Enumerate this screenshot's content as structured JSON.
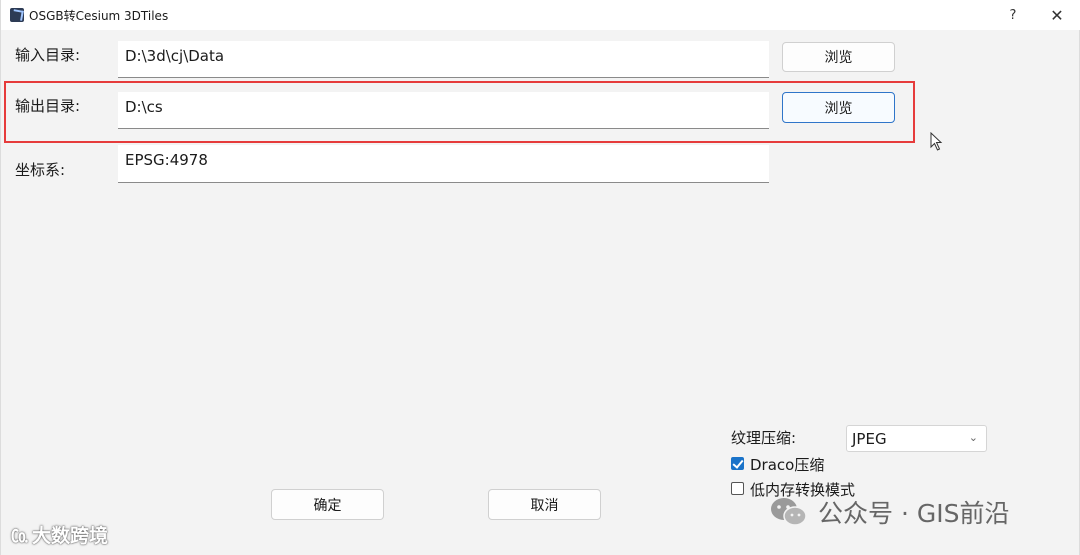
{
  "window": {
    "title": "OSGB转Cesium 3DTiles",
    "help_label": "?",
    "close_label": "✕"
  },
  "form": {
    "input_dir_label": "输入目录:",
    "input_dir_value": "D:\\3d\\cj\\Data",
    "output_dir_label": "输出目录:",
    "output_dir_value": "D:\\cs",
    "crs_label": "坐标系:",
    "crs_value": "EPSG:4978",
    "browse_label": "浏览"
  },
  "options": {
    "texture_compress_label": "纹理压缩:",
    "texture_compress_value": "JPEG",
    "draco_label": "Draco压缩",
    "draco_checked": true,
    "low_memory_label": "低内存转换模式",
    "low_memory_checked": false
  },
  "actions": {
    "ok_label": "确定",
    "cancel_label": "取消"
  },
  "watermarks": {
    "left": "大数跨境",
    "right": "公众号 · GIS前沿"
  },
  "colors": {
    "highlight": "#e63b3b",
    "accent": "#1a73c9"
  }
}
